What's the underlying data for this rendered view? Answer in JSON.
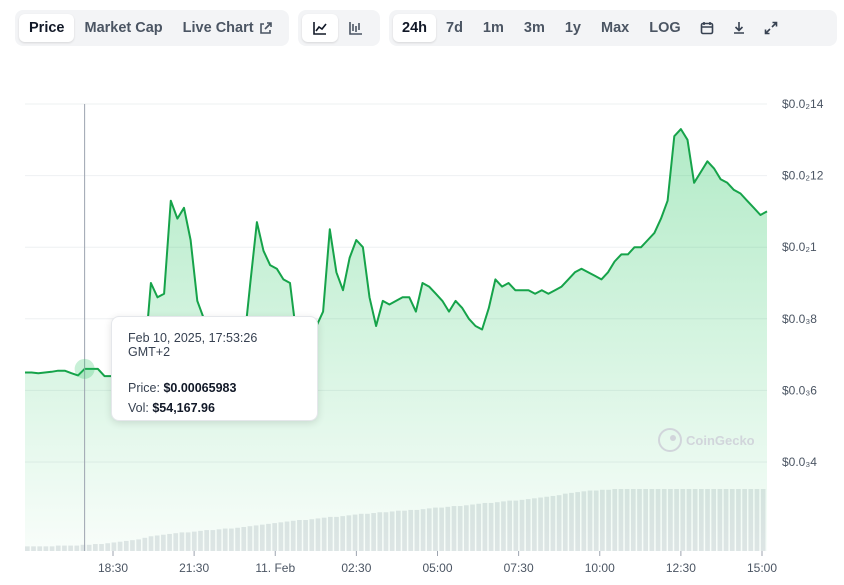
{
  "toolbar": {
    "tabs": [
      "Price",
      "Market Cap",
      "Live Chart"
    ],
    "active_tab": "Price",
    "ranges": [
      "24h",
      "7d",
      "1m",
      "3m",
      "1y",
      "Max",
      "LOG"
    ],
    "active_range": "24h"
  },
  "tooltip": {
    "date": "Feb 10, 2025, 17:53:26 GMT+2",
    "price_label": "Price:",
    "price_value": "$0.00065983",
    "vol_label": "Vol:",
    "vol_value": "$54,167.96"
  },
  "watermark": "CoinGecko",
  "colors": {
    "line": "#16a34a",
    "area": "#22c55e",
    "volume": "#d1d5db"
  },
  "chart_data": {
    "type": "area",
    "x_tick_labels": [
      "18:30",
      "21:30",
      "11. Feb",
      "02:30",
      "05:00",
      "07:30",
      "10:00",
      "12:30",
      "15:00"
    ],
    "y_tick_labels": [
      "$0.0₂14",
      "$0.0₂12",
      "$0.0₂1",
      "$0.0₃8",
      "$0.0₃6",
      "$0.0₃4"
    ],
    "y_tick_values": [
      0.0014,
      0.0012,
      0.001,
      0.0008,
      0.0006,
      0.0004
    ],
    "ylim": [
      0.0004,
      0.0014
    ],
    "grid": true,
    "hover_index": 9,
    "series": [
      {
        "values": [
          0.00065,
          0.00065,
          0.000648,
          0.00065,
          0.000652,
          0.000655,
          0.000655,
          0.000648,
          0.000642,
          0.00066,
          0.00066,
          0.00066,
          0.00064,
          0.00064,
          0.00065,
          0.00066,
          0.00066,
          0.00067,
          0.00068,
          0.0009,
          0.00086,
          0.00087,
          0.00113,
          0.00108,
          0.00111,
          0.00102,
          0.00085,
          0.0008,
          0.0007,
          0.00068,
          0.00068,
          0.00068,
          0.0007,
          0.00072,
          0.0009,
          0.00107,
          0.00099,
          0.00095,
          0.00094,
          0.00091,
          0.0009,
          0.00075,
          0.00076,
          0.00079,
          0.00078,
          0.00082,
          0.00105,
          0.00093,
          0.00088,
          0.00097,
          0.00102,
          0.001,
          0.00086,
          0.00078,
          0.00085,
          0.00084,
          0.00085,
          0.00086,
          0.00086,
          0.00082,
          0.0009,
          0.00089,
          0.00087,
          0.00085,
          0.00082,
          0.00085,
          0.00083,
          0.0008,
          0.00078,
          0.00077,
          0.00083,
          0.00091,
          0.00089,
          0.0009,
          0.00088,
          0.00088,
          0.00088,
          0.00087,
          0.00088,
          0.00087,
          0.00088,
          0.00089,
          0.00091,
          0.00093,
          0.00094,
          0.00093,
          0.00092,
          0.00091,
          0.00093,
          0.00096,
          0.00098,
          0.00098,
          0.001,
          0.001,
          0.00102,
          0.00104,
          0.00108,
          0.00113,
          0.00131,
          0.00133,
          0.0013,
          0.00118,
          0.00121,
          0.00124,
          0.00122,
          0.00119,
          0.00118,
          0.00116,
          0.00115,
          0.00113,
          0.00111,
          0.00109,
          0.0011
        ]
      }
    ],
    "volume": [
      6,
      6,
      6,
      6,
      6,
      7,
      7,
      7,
      7,
      8,
      8,
      9,
      9,
      10,
      11,
      12,
      13,
      14,
      15,
      17,
      19,
      20,
      21,
      22,
      23,
      24,
      24,
      25,
      26,
      27,
      27,
      28,
      29,
      29,
      30,
      31,
      32,
      33,
      34,
      35,
      36,
      37,
      38,
      39,
      40,
      40,
      41,
      42,
      43,
      44,
      44,
      45,
      46,
      47,
      48,
      48,
      49,
      50,
      50,
      51,
      52,
      52,
      53,
      53,
      54,
      55,
      56,
      56,
      57,
      58,
      58,
      59,
      60,
      61,
      62,
      62,
      63,
      64,
      65,
      65,
      66,
      67,
      68,
      69,
      70,
      71,
      72,
      74,
      75,
      76,
      77,
      78,
      78,
      79,
      79,
      80,
      80,
      80,
      80,
      80,
      80,
      80,
      80,
      80,
      80,
      80,
      80,
      80,
      80,
      80,
      80,
      80,
      80,
      80,
      80,
      80,
      80,
      80,
      80,
      80
    ]
  }
}
